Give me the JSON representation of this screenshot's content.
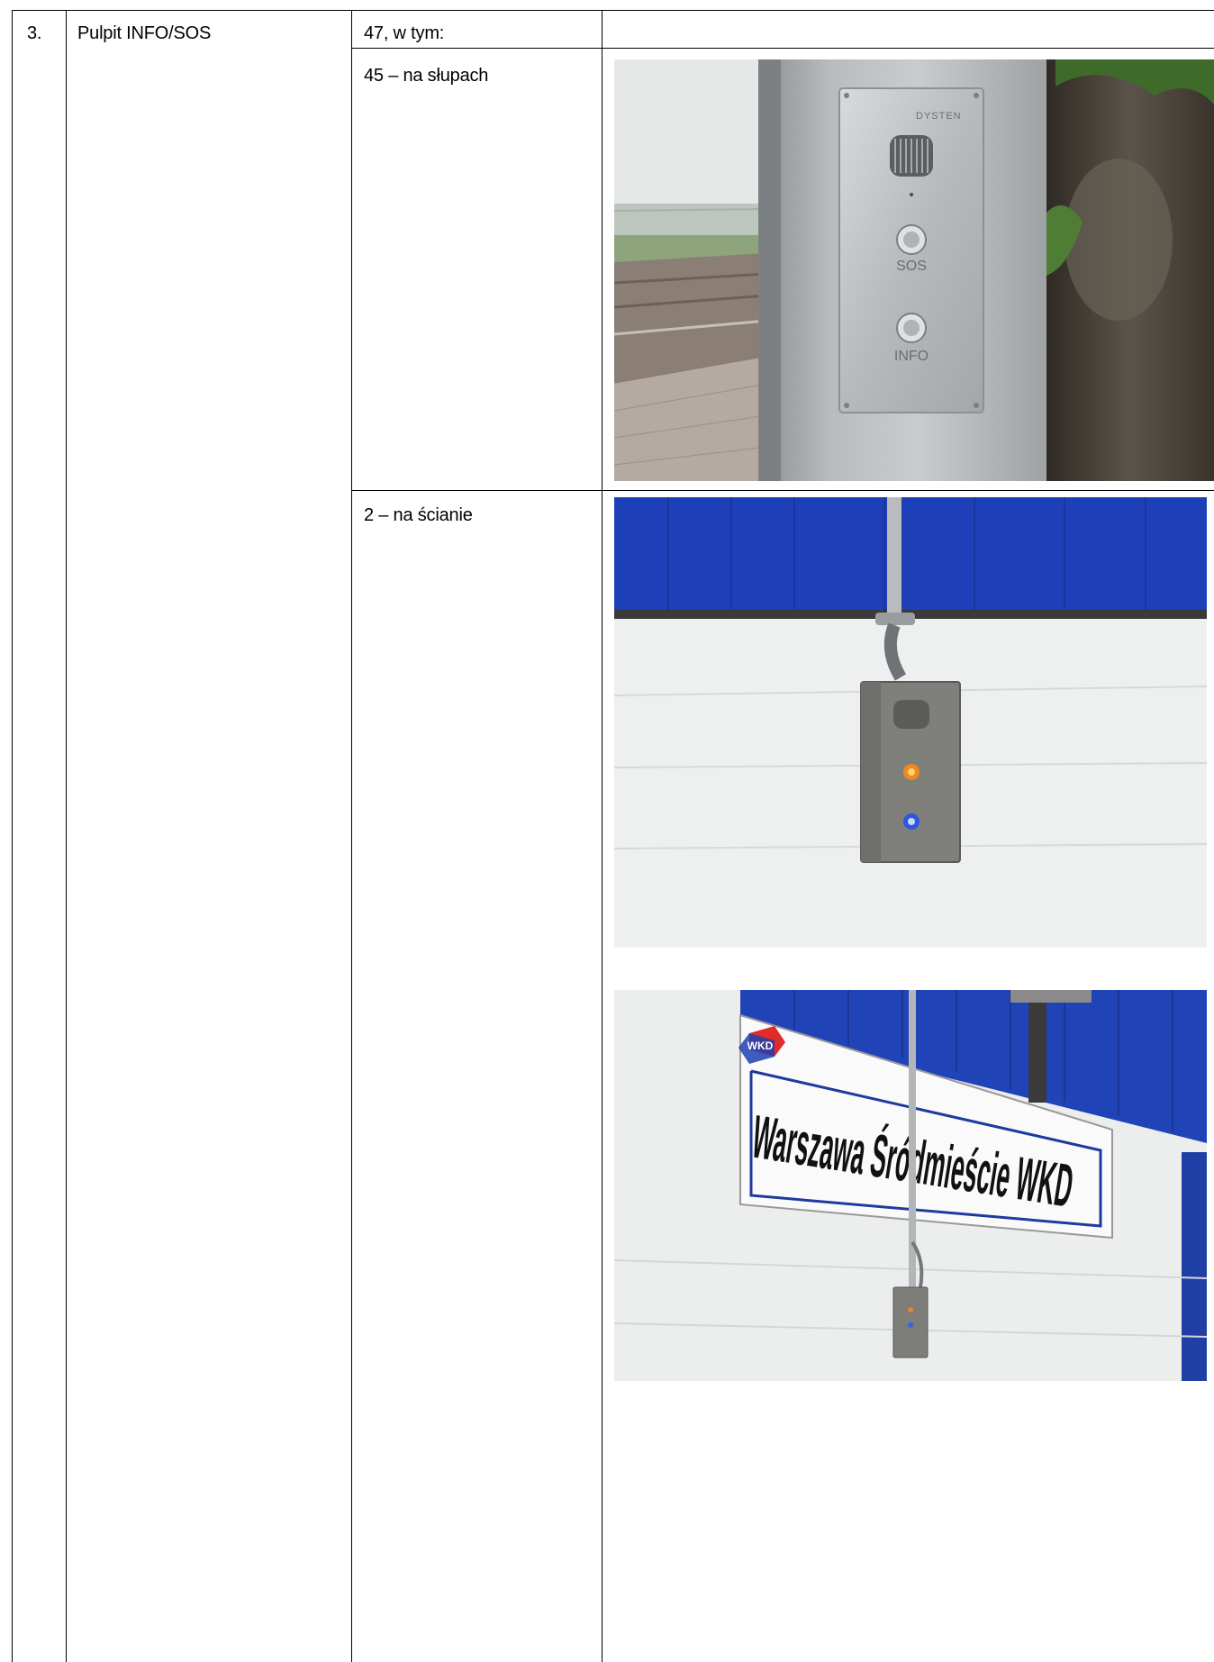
{
  "row": {
    "number": "3.",
    "name": "Pulpit INFO/SOS",
    "count": "47, w tym:",
    "items": [
      {
        "label": "45 – na słupach"
      },
      {
        "label": "2 – na ścianie"
      }
    ]
  },
  "photos": {
    "pole_unit": {
      "brand": "DYSTEN",
      "sos_label": "SOS",
      "info_label": "INFO"
    },
    "wall_unit": {},
    "station_sign": {
      "logo": "WKD",
      "sign_text": "Warszawa Śródmieście WKD"
    }
  }
}
